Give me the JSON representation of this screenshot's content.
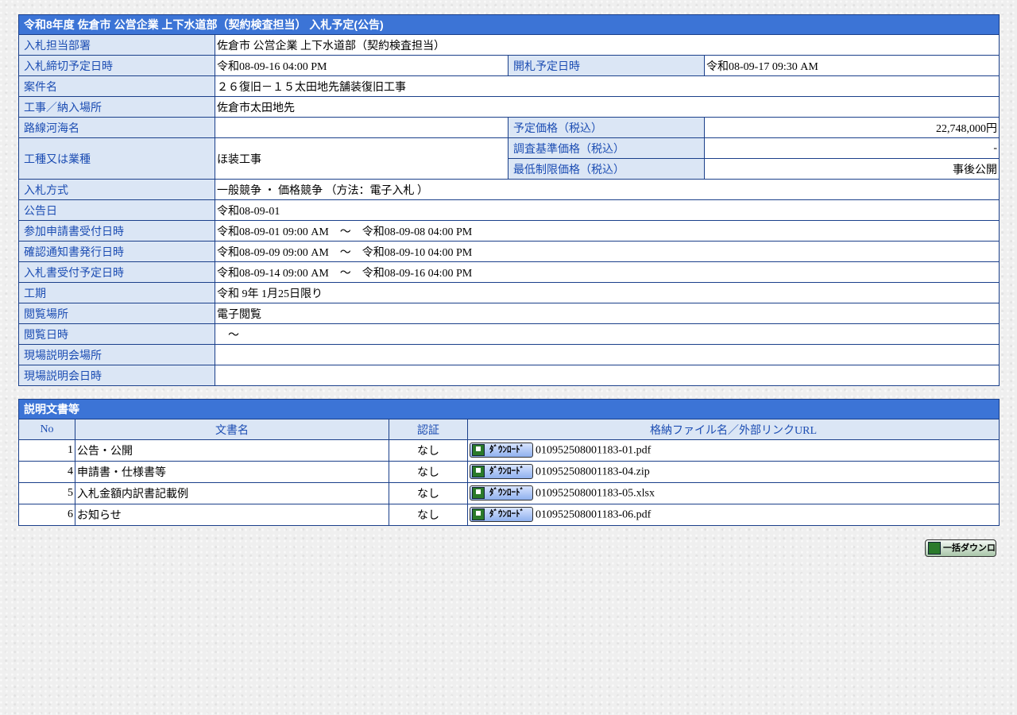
{
  "notice": {
    "title": "令和8年度 佐倉市 公営企業 上下水道部（契約検査担当） 入札予定(公告)",
    "rows": {
      "dept": {
        "label": "入札担当部署",
        "value": "佐倉市 公営企業 上下水道部（契約検査担当）"
      },
      "deadline": {
        "label": "入札締切予定日時",
        "value": "令和08-09-16 04:00 PM"
      },
      "opening": {
        "label": "開札予定日時",
        "value": "令和08-09-17 09:30 AM"
      },
      "project": {
        "label": "案件名",
        "value": "２６復旧－１５太田地先舗装復旧工事"
      },
      "place": {
        "label": "工事／納入場所",
        "value": "佐倉市太田地先"
      },
      "route": {
        "label": "路線河海名",
        "value": ""
      },
      "planned_price": {
        "label": "予定価格（税込）",
        "value": "22,748,000円"
      },
      "category": {
        "label": "工種又は業種",
        "value": "ほ装工事"
      },
      "survey_price": {
        "label": "調査基準価格（税込）",
        "value": "-"
      },
      "min_price": {
        "label": "最低制限価格（税込）",
        "value": "事後公開"
      },
      "method": {
        "label": "入札方式",
        "value": "一般競争 ・ 価格競争 （方法：電子入札 ）"
      },
      "notice_date": {
        "label": "公告日",
        "value": "令和08-09-01"
      },
      "application": {
        "label": "参加申請書受付日時",
        "value": "令和08-09-01 09:00 AM　～　令和08-09-08 04:00 PM"
      },
      "confirmation": {
        "label": "確認通知書発行日時",
        "value": "令和08-09-09 09:00 AM　～　令和08-09-10 04:00 PM"
      },
      "bid_receipt": {
        "label": "入札書受付予定日時",
        "value": "令和08-09-14 09:00 AM　～　令和08-09-16 04:00 PM"
      },
      "period": {
        "label": "工期",
        "value": "令和 9年 1月25日限り"
      },
      "view_place": {
        "label": "閲覧場所",
        "value": "電子閲覧"
      },
      "view_date": {
        "label": "閲覧日時",
        "value": "　～"
      },
      "site_place": {
        "label": "現場説明会場所",
        "value": ""
      },
      "site_date": {
        "label": "現場説明会日時",
        "value": ""
      }
    }
  },
  "documents": {
    "title": "説明文書等",
    "headers": {
      "no": "No",
      "name": "文書名",
      "auth": "認証",
      "file": "格納ファイル名／外部リンクURL"
    },
    "download_label": "ﾀﾞｳﾝﾛｰﾄﾞ",
    "items": [
      {
        "no": "1",
        "name": "公告・公開",
        "auth": "なし",
        "file": "010952508001183-01.pdf"
      },
      {
        "no": "4",
        "name": "申請書・仕様書等",
        "auth": "なし",
        "file": "010952508001183-04.zip"
      },
      {
        "no": "5",
        "name": "入札金額内訳書記載例",
        "auth": "なし",
        "file": "010952508001183-05.xlsx"
      },
      {
        "no": "6",
        "name": "お知らせ",
        "auth": "なし",
        "file": "010952508001183-06.pdf"
      }
    ],
    "bulk_label": "一括ダウンロード"
  },
  "colors": {
    "header_bg": "#3c74d6",
    "label_bg": "#dbe6f5",
    "label_text": "#1c4db3",
    "border": "#1a3f8a"
  },
  "icons": {
    "download": "download-floppy-icon",
    "bulk": "bulk-download-icon"
  }
}
